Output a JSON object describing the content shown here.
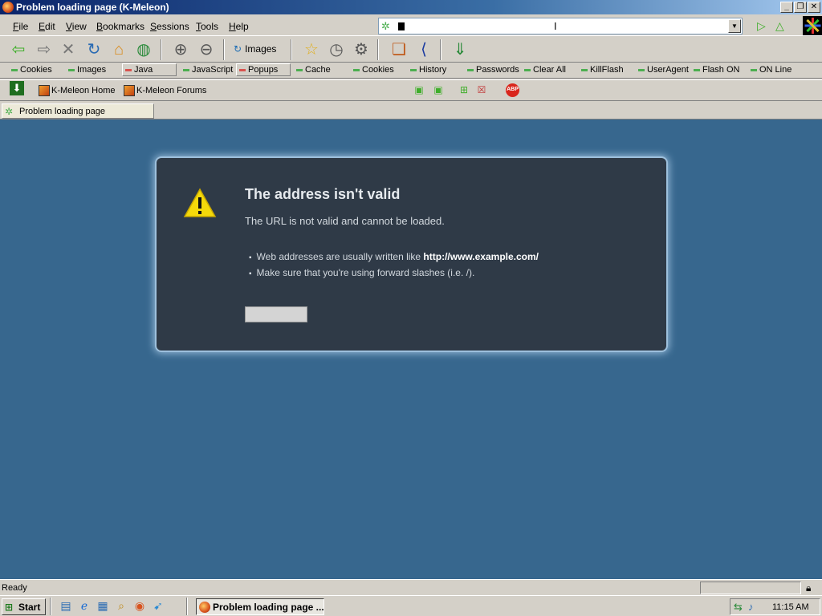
{
  "window": {
    "title": "Problem loading page (K-Meleon)",
    "controls": [
      "_",
      "❐",
      "✕"
    ]
  },
  "menu": [
    "File",
    "Edit",
    "View",
    "Bookmarks",
    "Sessions",
    "Tools",
    "Help"
  ],
  "urlbar": {
    "value": ""
  },
  "toolbar": {
    "images_label": "Images"
  },
  "privacy": [
    {
      "label": "Cookies",
      "state": "on"
    },
    {
      "label": "Images",
      "state": "on"
    },
    {
      "label": "Java",
      "state": "off"
    },
    {
      "label": "JavaScript",
      "state": "on"
    },
    {
      "label": "Popups",
      "state": "off"
    },
    {
      "label": "Cache",
      "state": "on"
    },
    {
      "label": "Cookies",
      "state": "on"
    },
    {
      "label": "History",
      "state": "on"
    },
    {
      "label": "Passwords",
      "state": "on"
    },
    {
      "label": "Clear All",
      "state": "on"
    },
    {
      "label": "KillFlash",
      "state": "on"
    },
    {
      "label": "UserAgent",
      "state": "on"
    },
    {
      "label": "Flash ON",
      "state": "on"
    },
    {
      "label": "ON Line",
      "state": "on"
    }
  ],
  "bookmarks": [
    "K-Meleon Home",
    "K-Meleon Forums"
  ],
  "tab": {
    "label": "Problem loading page"
  },
  "error": {
    "title": "The address isn't valid",
    "description": "The URL is not valid and cannot be loaded.",
    "bullet1_prefix": "Web addresses are usually written like ",
    "bullet1_bold": "http://www.example.com/",
    "bullet2": "Make sure that you're using forward slashes (i.e. /).",
    "button_label": ""
  },
  "status": {
    "text": "Ready"
  },
  "taskbar": {
    "start_label": "Start",
    "task_label": "Problem loading page ...",
    "clock": "11:15 AM"
  },
  "colors": {
    "content_bg": "#37678e",
    "error_bg": "#2f3a47",
    "title_bar": "#0a246a"
  }
}
